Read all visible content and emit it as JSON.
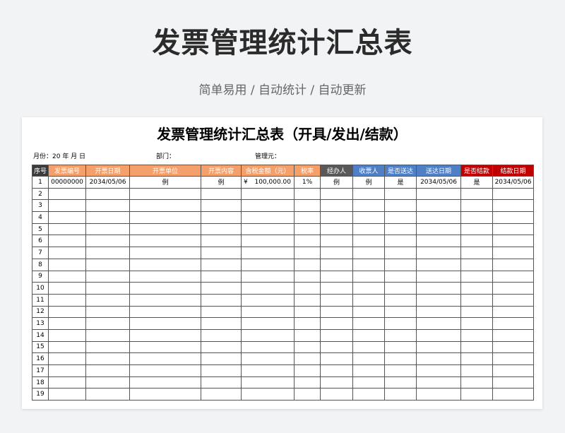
{
  "banner": {
    "title": "发票管理统计汇总表",
    "subtitle": "简单易用 / 自动统计 / 自动更新"
  },
  "sheet": {
    "title": "发票管理统计汇总表（开具/发出/结款）",
    "meta": {
      "month": "月份：20  年  月  日",
      "department": "部门：",
      "manager": "管理元："
    },
    "columns": [
      {
        "label": "序号",
        "color": "#3b3b3b"
      },
      {
        "label": "发票编号",
        "color": "#f5a06a"
      },
      {
        "label": "开票日期",
        "color": "#f5a06a"
      },
      {
        "label": "开票单位",
        "color": "#f5a06a"
      },
      {
        "label": "开票内容",
        "color": "#f5a06a"
      },
      {
        "label": "含税金额（元）",
        "color": "#f5a06a"
      },
      {
        "label": "税率",
        "color": "#f5a06a"
      },
      {
        "label": "经办人",
        "color": "#595959"
      },
      {
        "label": "收票人",
        "color": "#4f7fc4"
      },
      {
        "label": "是否送达",
        "color": "#4f7fc4"
      },
      {
        "label": "送达日期",
        "color": "#4f7fc4"
      },
      {
        "label": "是否结款",
        "color": "#c00000"
      },
      {
        "label": "结款日期",
        "color": "#c00000"
      }
    ],
    "example_row": {
      "index": "1",
      "invoice_no": "00000000",
      "issue_date": "2034/05/06",
      "issuer": "例",
      "content": "例",
      "currency": "¥",
      "amount": "100,000.00",
      "tax_rate": "1%",
      "handler": "例",
      "receiver": "例",
      "delivered": "是",
      "delivery_date": "2034/05/06",
      "settled": "是",
      "settle_date": "2034/05/06"
    },
    "row_numbers": [
      "2",
      "3",
      "4",
      "5",
      "6",
      "7",
      "8",
      "9",
      "10",
      "11",
      "12",
      "13",
      "14",
      "15",
      "16",
      "17",
      "18",
      "19"
    ]
  }
}
